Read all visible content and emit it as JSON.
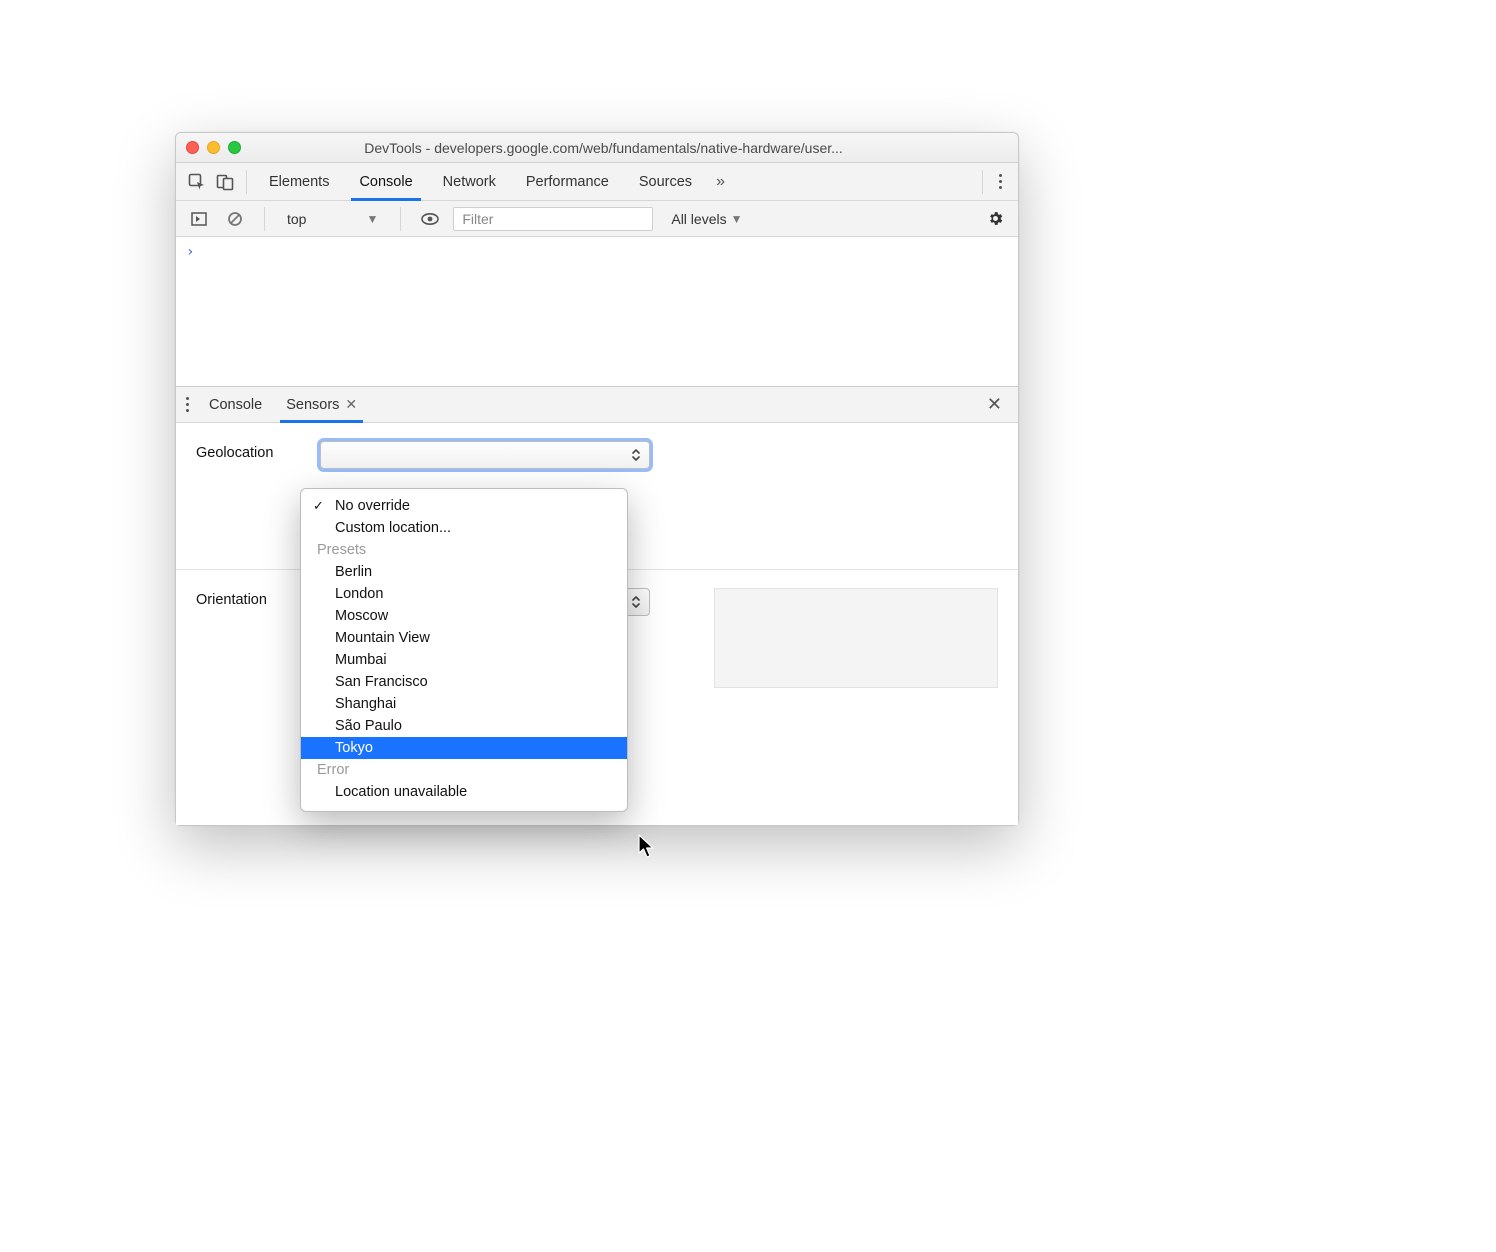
{
  "window": {
    "title": "DevTools - developers.google.com/web/fundamentals/native-hardware/user..."
  },
  "main_tabs": {
    "items": [
      "Elements",
      "Console",
      "Network",
      "Performance",
      "Sources"
    ],
    "active_index": 1
  },
  "console_bar": {
    "context": "top",
    "filter_placeholder": "Filter",
    "levels_label": "All levels"
  },
  "drawer": {
    "tabs": [
      "Console",
      "Sensors"
    ],
    "active_index": 1
  },
  "sensors": {
    "geolocation_label": "Geolocation",
    "orientation_label": "Orientation"
  },
  "geo_menu": {
    "options": [
      "No override",
      "Custom location..."
    ],
    "checked_index": 0,
    "group1_label": "Presets",
    "presets": [
      "Berlin",
      "London",
      "Moscow",
      "Mountain View",
      "Mumbai",
      "San Francisco",
      "Shanghai",
      "São Paulo",
      "Tokyo"
    ],
    "highlighted_preset_index": 8,
    "group2_label": "Error",
    "errors": [
      "Location unavailable"
    ]
  }
}
